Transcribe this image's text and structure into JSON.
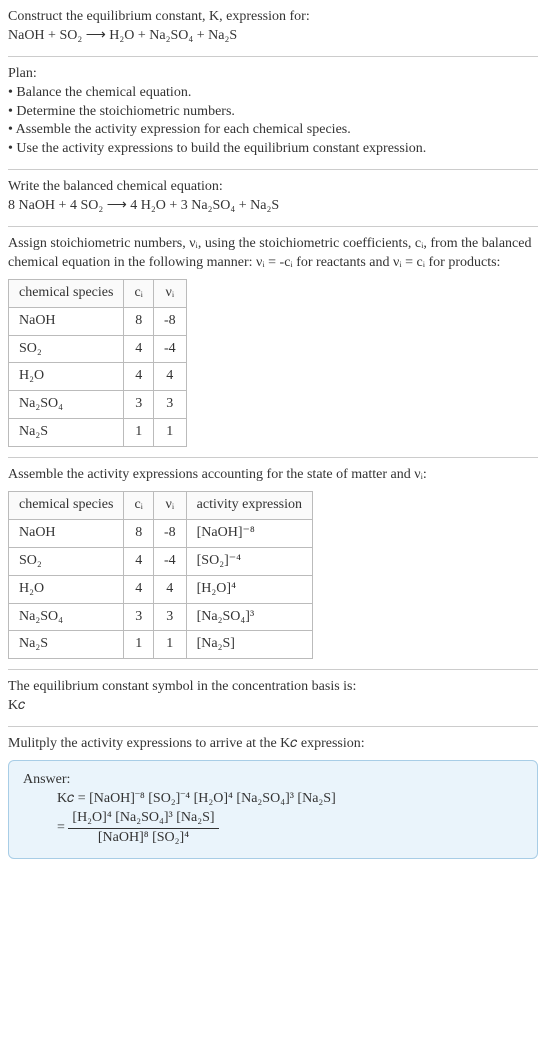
{
  "intro": {
    "line1": "Construct the equilibrium constant, K, expression for:",
    "equation": "NaOH + SO₂ ⟶ H₂O + Na₂SO₄ + Na₂S"
  },
  "plan": {
    "heading": "Plan:",
    "items": [
      "Balance the chemical equation.",
      "Determine the stoichiometric numbers.",
      "Assemble the activity expression for each chemical species.",
      "Use the activity expressions to build the equilibrium constant expression."
    ]
  },
  "balanced": {
    "heading": "Write the balanced chemical equation:",
    "equation": "8 NaOH + 4 SO₂ ⟶ 4 H₂O + 3 Na₂SO₄ + Na₂S"
  },
  "stoich": {
    "heading": "Assign stoichiometric numbers, νᵢ, using the stoichiometric coefficients, cᵢ, from the balanced chemical equation in the following manner: νᵢ = -cᵢ for reactants and νᵢ = cᵢ for products:",
    "headers": {
      "sp": "chemical species",
      "c": "cᵢ",
      "v": "νᵢ"
    },
    "rows": [
      {
        "sp": "NaOH",
        "c": "8",
        "v": "-8"
      },
      {
        "sp": "SO₂",
        "c": "4",
        "v": "-4"
      },
      {
        "sp": "H₂O",
        "c": "4",
        "v": "4"
      },
      {
        "sp": "Na₂SO₄",
        "c": "3",
        "v": "3"
      },
      {
        "sp": "Na₂S",
        "c": "1",
        "v": "1"
      }
    ]
  },
  "activity": {
    "heading": "Assemble the activity expressions accounting for the state of matter and νᵢ:",
    "headers": {
      "sp": "chemical species",
      "c": "cᵢ",
      "v": "νᵢ",
      "ae": "activity expression"
    },
    "rows": [
      {
        "sp": "NaOH",
        "c": "8",
        "v": "-8",
        "ae": "[NaOH]⁻⁸"
      },
      {
        "sp": "SO₂",
        "c": "4",
        "v": "-4",
        "ae": "[SO₂]⁻⁴"
      },
      {
        "sp": "H₂O",
        "c": "4",
        "v": "4",
        "ae": "[H₂O]⁴"
      },
      {
        "sp": "Na₂SO₄",
        "c": "3",
        "v": "3",
        "ae": "[Na₂SO₄]³"
      },
      {
        "sp": "Na₂S",
        "c": "1",
        "v": "1",
        "ae": "[Na₂S]"
      }
    ]
  },
  "symbol": {
    "line1": "The equilibrium constant symbol in the concentration basis is:",
    "line2": "K𝑐"
  },
  "multiply": {
    "heading": "Mulitply the activity expressions to arrive at the K𝑐 expression:"
  },
  "answer": {
    "label": "Answer:",
    "flat": "K𝑐 = [NaOH]⁻⁸ [SO₂]⁻⁴ [H₂O]⁴ [Na₂SO₄]³ [Na₂S]",
    "num": "[H₂O]⁴ [Na₂SO₄]³ [Na₂S]",
    "den": "[NaOH]⁸ [SO₂]⁴"
  }
}
